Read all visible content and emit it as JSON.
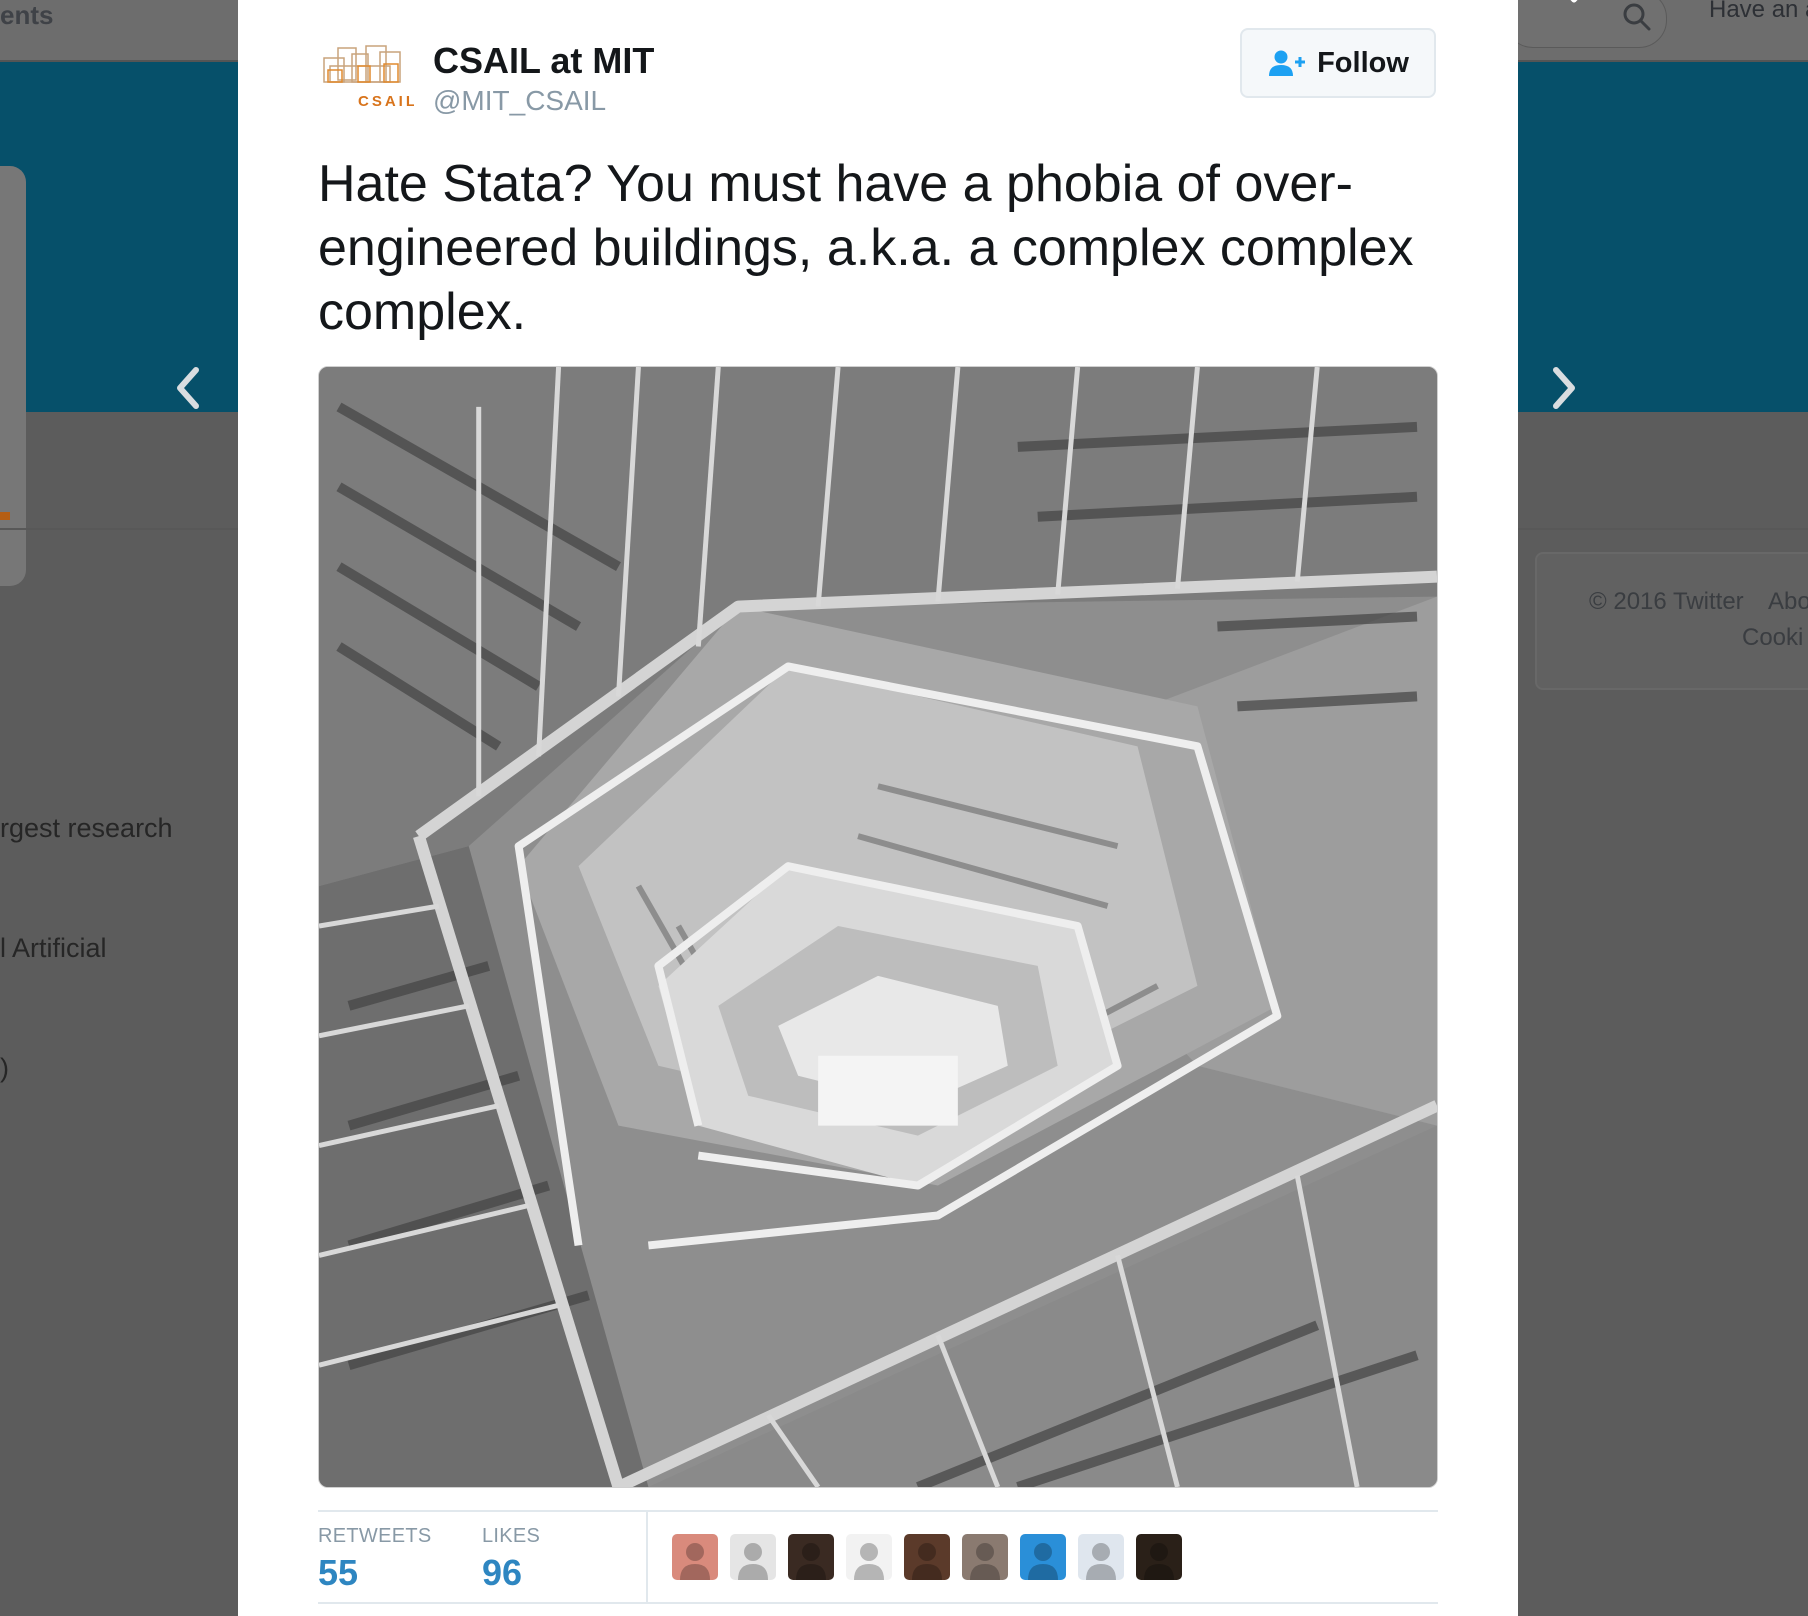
{
  "background": {
    "nav_fragment": "ents",
    "search_hint": "Have an a",
    "bio_lines": [
      "rgest research",
      "l Artificial",
      ")"
    ],
    "footer": {
      "copyright": "© 2016 Twitter",
      "about": "Abo",
      "cookies": "Cooki"
    },
    "banner_color": "#06506a"
  },
  "modal": {
    "user": {
      "name": "CSAIL at MIT",
      "handle": "@MIT_CSAIL",
      "avatar_label": "CSAIL"
    },
    "follow_button": {
      "label": "Follow",
      "icon": "add-user-icon"
    },
    "tweet": {
      "text_lines": [
        "Hate Stata? You must have a phobia of over-",
        "engineered buildings, a.k.a. a complex complex",
        "complex."
      ],
      "photo": "black-and-white-spiral-staircase-photo"
    },
    "stats": {
      "retweets_label": "RETWEETS",
      "retweets_count": "55",
      "likes_label": "LIKES",
      "likes_count": "96"
    },
    "likers": [
      {
        "icon": "liker-avatar-1",
        "color": "#d98a7c"
      },
      {
        "icon": "liker-avatar-2",
        "color": "#e5e5e5"
      },
      {
        "icon": "liker-avatar-3",
        "color": "#3a2a22"
      },
      {
        "icon": "liker-avatar-4",
        "color": "#f2f2f2"
      },
      {
        "icon": "liker-avatar-5",
        "color": "#5b3a2a"
      },
      {
        "icon": "liker-avatar-6",
        "color": "#8a7a70"
      },
      {
        "icon": "liker-avatar-7",
        "color": "#2a8fd8"
      },
      {
        "icon": "liker-avatar-8",
        "color": "#dfe6ee"
      },
      {
        "icon": "liker-avatar-9",
        "color": "#2a2018"
      }
    ]
  },
  "colors": {
    "link_blue": "#2e86c1",
    "overlay": "#5c5c5c",
    "text_dark": "#14171a",
    "text_muted": "#8899a6"
  }
}
